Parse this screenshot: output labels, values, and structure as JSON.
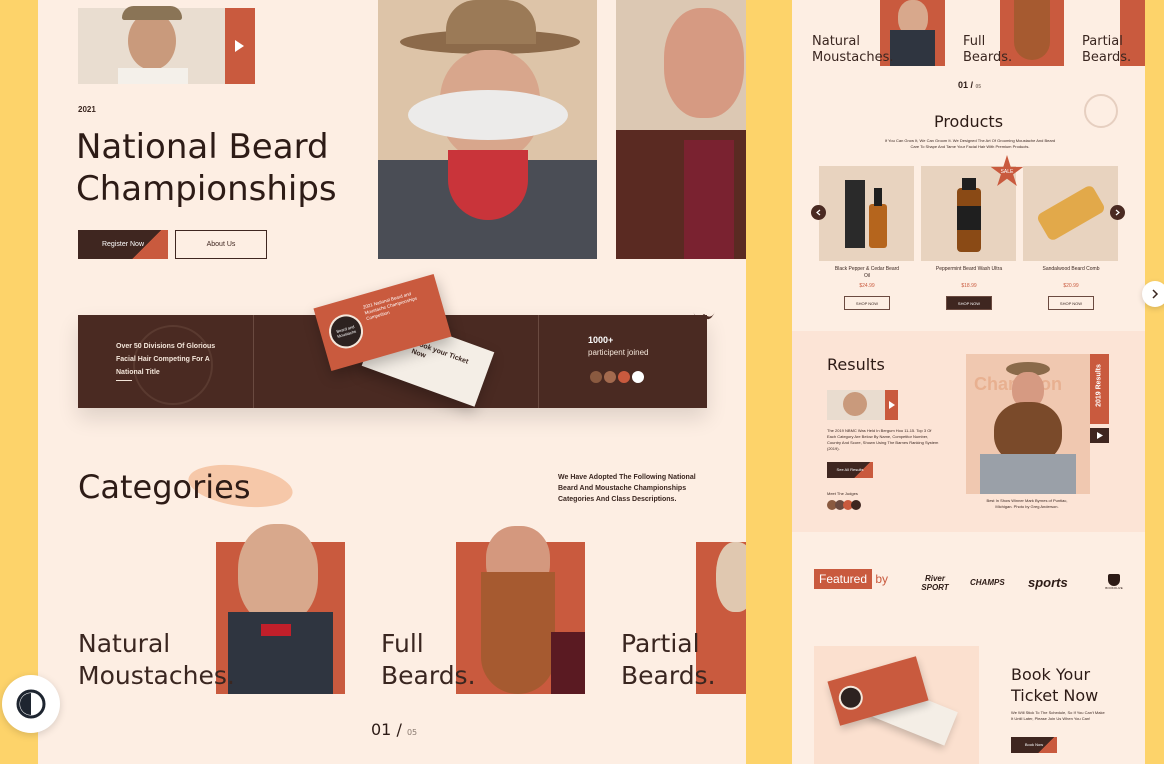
{
  "hero": {
    "year": "2021",
    "title_line1": "National Beard",
    "title_line2": "Championships",
    "register_label": "Register Now",
    "about_label": "About Us"
  },
  "banner": {
    "divisions_text": "Over 50 Divisions Of Glorious Facial Hair Competing For A National Title",
    "participants_count": "1000+",
    "participants_label": "participent joined",
    "ticket_title": "2021 National Beard and Moustache Championships Competition",
    "ticket_cta": "Book your Ticket Now",
    "badge_text": "Beard and Moustache"
  },
  "categories": {
    "heading": "Categories",
    "description": "We Have Adopted The Following National Beard And Moustache Championships Categories And Class Descriptions.",
    "items": [
      {
        "line1": "Natural",
        "line2": "Moustaches."
      },
      {
        "line1": "Full",
        "line2": "Beards."
      },
      {
        "line1": "Partial",
        "line2": "Beards."
      }
    ],
    "pager_current": "01",
    "pager_sep": "/",
    "pager_total": "05"
  },
  "right": {
    "categories_items": [
      {
        "line1": "Natural",
        "line2": "Moustaches."
      },
      {
        "line1": "Full",
        "line2": "Beards."
      },
      {
        "line1": "Partial",
        "line2": "Beards."
      }
    ],
    "pager_current": "01 /",
    "pager_total": "05",
    "products_heading": "Products",
    "products_sub": "If You Can Grow It, We Can Groom It. We Designed The Art Of Grooming Moustache And Beard Care To Shape And Tame Your Facial Hair With Premium Products.",
    "products": [
      {
        "name": "Black Pepper & Cedar Beard Oil",
        "price": "$24.99",
        "cta": "SHOP NOW"
      },
      {
        "name": "Peppermint Beard Wash Ultra",
        "price": "$18.99",
        "cta": "SHOP NOW"
      },
      {
        "name": "Sandalwood Beard Comb",
        "price": "$20.99",
        "cta": "SHOP NOW"
      }
    ],
    "sale_badge": "SALE",
    "results_heading": "Results",
    "results_year": "2019 Results",
    "results_watermark": "Champion",
    "results_text": "The 2019 NBMC Was Held In Bergum Hoo 11-15. Top 3 Of Each Category Are Below By Name, Competitor Number, Country And Score, Shown Using The Barnes Ranking System (2019).",
    "results_button": "See All Results",
    "judges_label": "Meet The Judges",
    "results_caption": "Best In Show Winner Mark Byrnes of Puntiac, Michigan. Photo by Greg Anderson.",
    "featured_prefix": "Featured",
    "featured_suffix": " by",
    "sponsors": [
      "River SPORT",
      "CHAMPS",
      "sports",
      "BOOKOLIVE"
    ],
    "book_line1": "Book Your",
    "book_line2": "Ticket Now",
    "book_text": "We Will Stick To The Schedule, So If You Can't Make It Until Later, Please Join Us When You Can!",
    "book_button": "Book Now"
  },
  "colors": {
    "accent": "#c95a3e",
    "dark": "#4a2a22",
    "page_bg": "#fdeee3",
    "frame_bg": "#fdd36a"
  },
  "icons": [
    "play-icon",
    "contrast-icon",
    "chevron-right-icon",
    "arrow-left-icon",
    "arrow-right-icon",
    "moustache-icon"
  ]
}
